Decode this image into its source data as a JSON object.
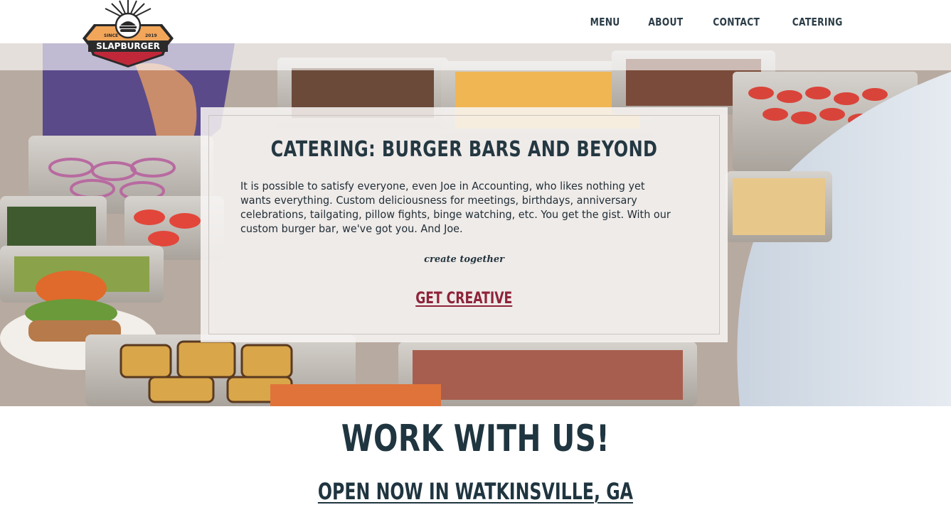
{
  "header": {
    "logo": {
      "text": "SLAPBURGER",
      "since": "SINCE",
      "year": "2019"
    },
    "nav": [
      {
        "label": "MENU"
      },
      {
        "label": "ABOUT"
      },
      {
        "label": "CONTACT"
      },
      {
        "label": "CATERING"
      }
    ]
  },
  "hero": {
    "card": {
      "title": "CATERING: BURGER BARS AND BEYOND",
      "body": "It is possible to satisfy everyone, even Joe in Accounting, who likes nothing yet wants everything. Custom deliciousness for meetings, birthdays, anniversary celebrations, tailgating, pillow fights, binge watching, etc. You get the gist. With our custom burger bar, we've got you. And Joe.",
      "script_text": "create together",
      "cta_label": "GET CREATIVE"
    }
  },
  "sections": {
    "work_heading": "WORK WITH US!",
    "open_link": "OPEN NOW IN WATKINSVILLE, GA"
  },
  "colors": {
    "nav_text": "#2c3d47",
    "heading": "#1f3540",
    "accent": "#8e2339",
    "logo_orange": "#f2a65a",
    "logo_red": "#c0283a",
    "logo_dark": "#2b2a2a"
  }
}
